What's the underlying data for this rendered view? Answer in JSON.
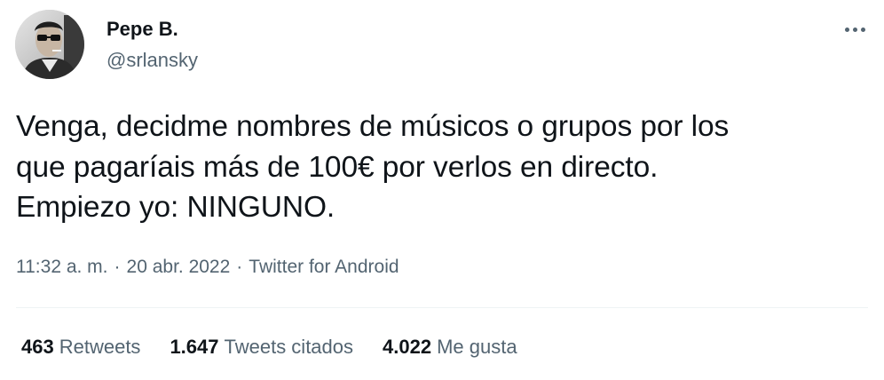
{
  "user": {
    "display_name": "Pepe B.",
    "handle": "@srlansky",
    "avatar": "profile-photo"
  },
  "more_icon": "more-horizontal-icon",
  "tweet": {
    "text": "Venga, decidme nombres de músicos o grupos por los\nque pagaríais más de 100€ por verlos en directo.\nEmpiezo yo: NINGUNO."
  },
  "meta": {
    "time": "11:32 a. m.",
    "separator": "·",
    "date": "20 abr. 2022",
    "source": "Twitter for Android"
  },
  "stats": {
    "retweets": {
      "count": "463",
      "label": "Retweets"
    },
    "quotes": {
      "count": "1.647",
      "label": "Tweets citados"
    },
    "likes": {
      "count": "4.022",
      "label": "Me gusta"
    }
  },
  "colors": {
    "text_primary": "#0f1419",
    "text_secondary": "#536471",
    "divider": "#eff3f4"
  }
}
